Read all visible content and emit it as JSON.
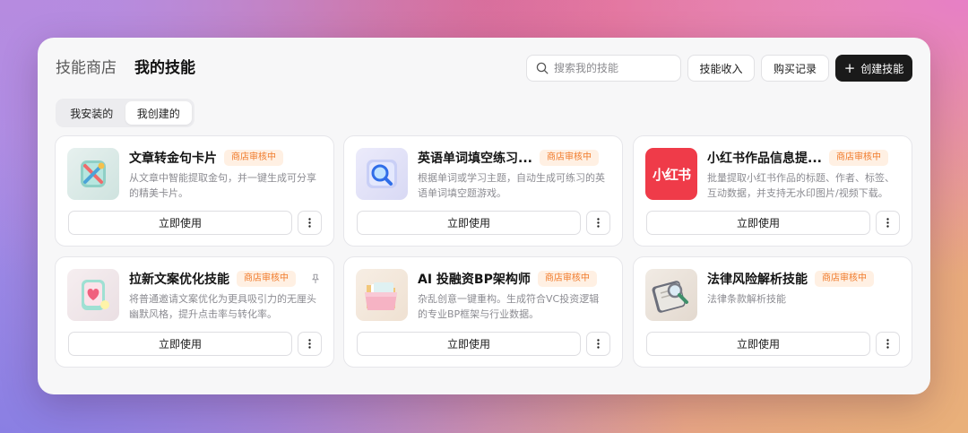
{
  "header": {
    "tabs": [
      {
        "label": "技能商店",
        "active": false
      },
      {
        "label": "我的技能",
        "active": true
      }
    ],
    "search": {
      "placeholder": "搜索我的技能",
      "icon": "search-icon"
    },
    "buttons": {
      "income": "技能收入",
      "purchase": "购买记录",
      "create": "创建技能",
      "create_icon": "+"
    }
  },
  "segment": {
    "items": [
      {
        "label": "我安装的",
        "active": false
      },
      {
        "label": "我创建的",
        "active": true
      }
    ]
  },
  "colors": {
    "badge_bg": "#fff0e3",
    "badge_text": "#f07a2a",
    "primary_button": "#1a1a1a",
    "xiaohongshu_red": "#ef3b49"
  },
  "cards": [
    {
      "title": "文章转金句卡片",
      "badge": "商店审核中",
      "desc": "从文章中智能提取金句，并一键生成可分享的精美卡片。",
      "use_label": "立即使用",
      "icon": "tools-icon",
      "pinned": false
    },
    {
      "title": "英语单词填空练习...",
      "badge": "商店审核中",
      "desc": "根据单词或学习主题，自动生成可练习的英语单词填空题游戏。",
      "use_label": "立即使用",
      "icon": "magnifier-icon",
      "pinned": false
    },
    {
      "title": "小红书作品信息提...",
      "badge": "商店审核中",
      "desc": "批量提取小红书作品的标题、作者、标签、互动数据，并支持无水印图片/视频下载。",
      "use_label": "立即使用",
      "icon": "xiaohongshu-logo-icon",
      "icon_text": "小红书",
      "pinned": false
    },
    {
      "title": "拉新文案优化技能",
      "badge": "商店审核中",
      "desc": "将普通邀请文案优化为更具吸引力的无厘头幽默风格，提升点击率与转化率。",
      "use_label": "立即使用",
      "icon": "heart-phone-icon",
      "pinned": true
    },
    {
      "title": "AI 投融资BP架构师",
      "badge": "商店审核中",
      "desc": "杂乱创意一键重构。生成符合VC投资逻辑的专业BP框架与行业数据。",
      "use_label": "立即使用",
      "icon": "folder-icon",
      "pinned": false
    },
    {
      "title": "法律风险解析技能",
      "badge": "商店审核中",
      "desc": "法律条款解析技能",
      "use_label": "立即使用",
      "icon": "legal-magnifier-icon",
      "pinned": false
    }
  ]
}
